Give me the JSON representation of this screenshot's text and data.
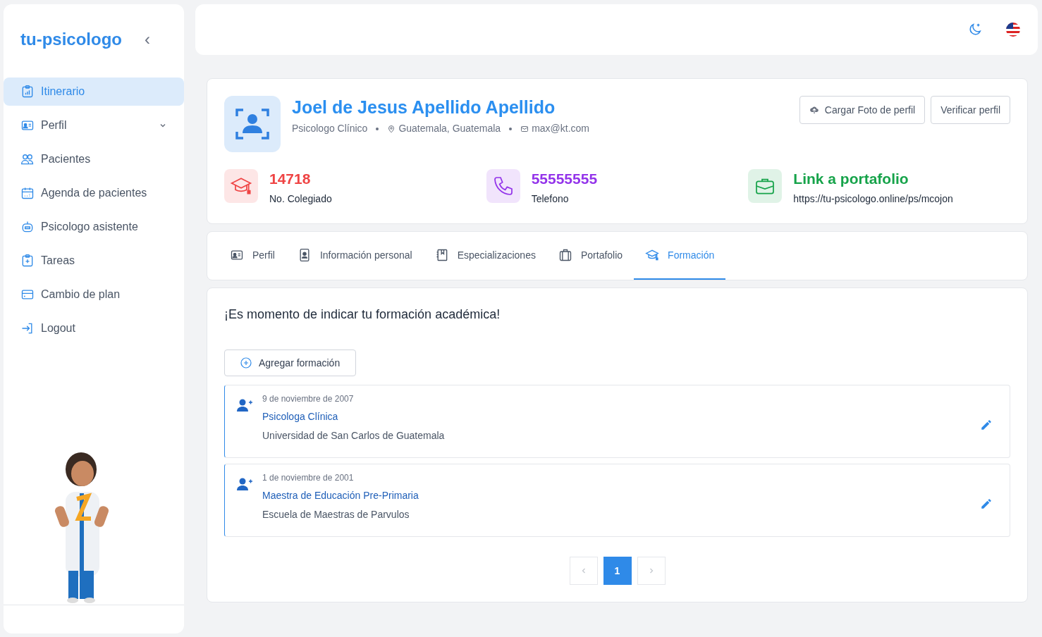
{
  "sidebar": {
    "logo": "tu-psicologo",
    "collapse_icon": "‹",
    "items": [
      {
        "label": "Itinerario",
        "kind": "link",
        "selected": true
      },
      {
        "label": "Perfil",
        "kind": "group",
        "expanded": false,
        "selected": false
      },
      {
        "label": "Pacientes",
        "kind": "link",
        "selected": false
      },
      {
        "label": "Agenda de pacientes",
        "kind": "link",
        "selected": false
      },
      {
        "label": "Psicologo asistente",
        "kind": "link",
        "selected": false
      },
      {
        "label": "Tareas",
        "kind": "link",
        "selected": false
      },
      {
        "label": "Cambio de plan",
        "kind": "link",
        "selected": false
      },
      {
        "label": "Logout",
        "kind": "link",
        "selected": false
      }
    ]
  },
  "profile": {
    "name": "Joel de Jesus Apellido Apellido",
    "role": "Psicologo Clínico",
    "location": "Guatemala, Guatemala",
    "email": "max@kt.com",
    "buttons": [
      "Cargar Foto de perfil",
      "Verificar perfil"
    ],
    "stats": [
      {
        "value": "14718",
        "label": "No. Colegiado",
        "color": "#ef4444"
      },
      {
        "value": "55555555",
        "label": "Telefono",
        "color": "#9333ea"
      },
      {
        "value": "Link a portafolio",
        "label": "https://tu-psicologo.online/ps/mcojon",
        "color": "#16a34a"
      }
    ]
  },
  "tabs": [
    {
      "label": "Perfil",
      "selected": false
    },
    {
      "label": "Información personal",
      "selected": false
    },
    {
      "label": "Especializaciones",
      "selected": false
    },
    {
      "label": "Portafolio",
      "selected": false
    },
    {
      "label": "Formación",
      "selected": true
    }
  ],
  "formacion": {
    "heading": "¡Es momento de indicar tu formación académica!",
    "add_button": "Agregar formación",
    "entries": [
      {
        "date": "9 de noviembre de 2007",
        "title": "Psicologa Clínica",
        "institution": "Universidad de San Carlos de Guatemala"
      },
      {
        "date": "1 de noviembre de 2001",
        "title": "Maestra de Educación Pre-Primaria",
        "institution": "Escuela de Maestras de Parvulos"
      }
    ],
    "pagination": [
      {
        "kind": "prev",
        "disabled": true,
        "selected": false
      },
      {
        "kind": "page",
        "label": "1",
        "selected": true
      },
      {
        "kind": "next",
        "disabled": true,
        "selected": false
      }
    ]
  }
}
